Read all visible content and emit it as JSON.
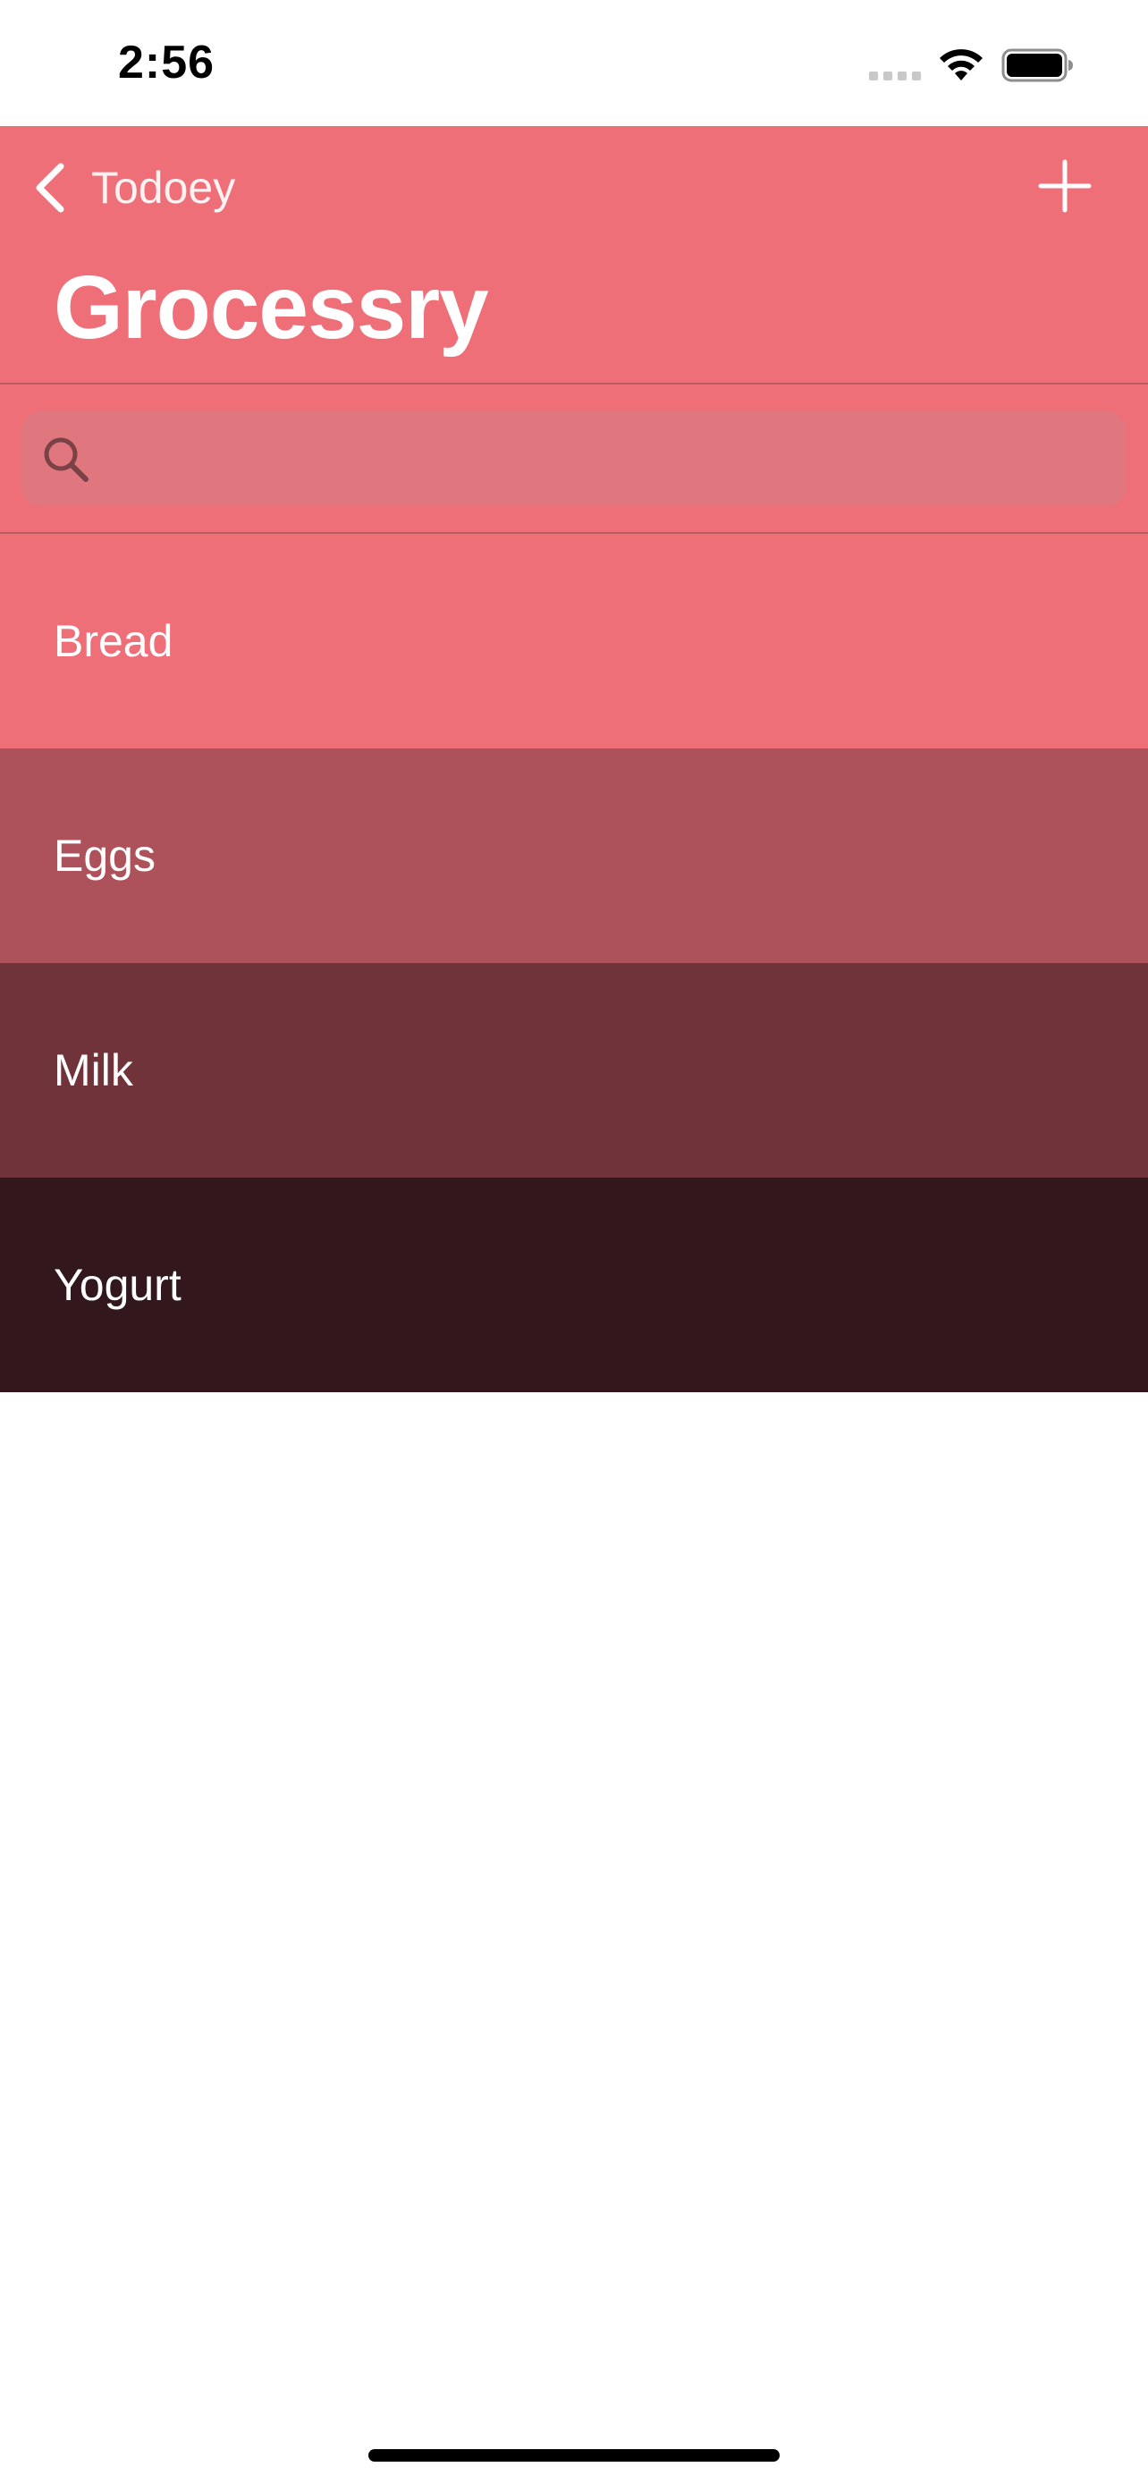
{
  "status_bar": {
    "time": "2:56"
  },
  "nav": {
    "back_label": "Todoey",
    "title": "Grocessry",
    "add_icon": "plus-icon",
    "back_icon": "chevron-left-icon",
    "background_color": "#ef6f78"
  },
  "search": {
    "placeholder": "",
    "value": "",
    "icon": "search-icon"
  },
  "items": [
    {
      "label": "Bread",
      "color": "#ef6f78"
    },
    {
      "label": "Eggs",
      "color": "#ad525a"
    },
    {
      "label": "Milk",
      "color": "#70333a"
    },
    {
      "label": "Yogurt",
      "color": "#32181c"
    }
  ]
}
